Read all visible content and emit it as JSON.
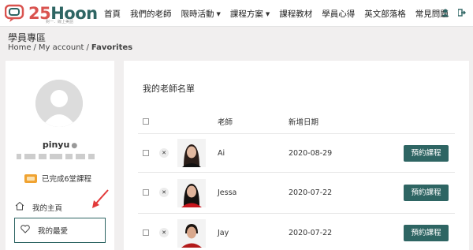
{
  "brand": {
    "name_num": "25",
    "name_word": "Hoon",
    "tagline": "對一．線上美語",
    "colors": {
      "accent": "#2e6563",
      "logo_red": "#d9534f"
    }
  },
  "nav": {
    "items": [
      {
        "label": "首頁",
        "dropdown": false
      },
      {
        "label": "我們的老師",
        "dropdown": false
      },
      {
        "label": "限時活動",
        "dropdown": true
      },
      {
        "label": "課程方案",
        "dropdown": true
      },
      {
        "label": "課程教材",
        "dropdown": false
      },
      {
        "label": "學員心得",
        "dropdown": false
      },
      {
        "label": "英文部落格",
        "dropdown": false
      },
      {
        "label": "常見問題",
        "dropdown": false
      }
    ],
    "icons": [
      "user-icon",
      "logout-icon"
    ]
  },
  "page": {
    "title": "學員專區",
    "breadcrumb": [
      "Home",
      "My account",
      "Favorites"
    ]
  },
  "sidebar": {
    "username": "pinyu",
    "completed_text": "已完成6堂課程",
    "menu": [
      {
        "label": "我的主頁",
        "icon": "home-icon"
      },
      {
        "label": "我的最愛",
        "icon": "heart-icon",
        "active": true
      }
    ]
  },
  "favorites": {
    "title": "我的老師名單",
    "columns": [
      "老師",
      "新增日期"
    ],
    "book_label": "預約課程",
    "rows": [
      {
        "name": "Ai",
        "date": "2020-08-29"
      },
      {
        "name": "Jessa",
        "date": "2020-07-22"
      },
      {
        "name": "Jay",
        "date": "2020-07-22"
      }
    ]
  }
}
